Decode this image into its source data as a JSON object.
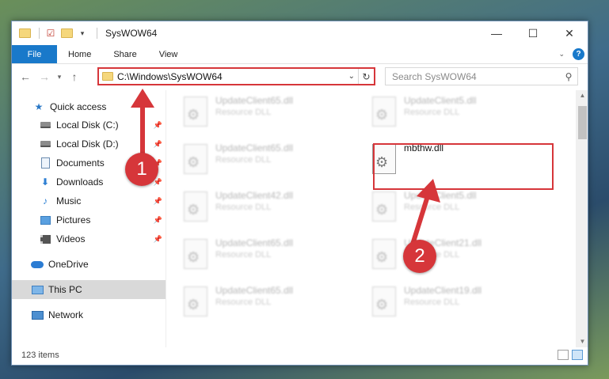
{
  "window": {
    "title": "SysWOW64",
    "controls": {
      "minimize": "—",
      "maximize": "☐",
      "close": "✕"
    }
  },
  "ribbon": {
    "file_label": "File",
    "tabs": [
      "Home",
      "Share",
      "View"
    ],
    "help": "?"
  },
  "nav": {
    "address": "C:\\Windows\\SysWOW64",
    "search_placeholder": "Search SysWOW64"
  },
  "sidebar": {
    "items": [
      {
        "label": "Quick access",
        "icon": "star-icon",
        "pinned": false
      },
      {
        "label": "Local Disk (C:)",
        "icon": "drive-icon",
        "pinned": true
      },
      {
        "label": "Local Disk (D:)",
        "icon": "drive-icon",
        "pinned": true
      },
      {
        "label": "Documents",
        "icon": "document-icon",
        "pinned": true
      },
      {
        "label": "Downloads",
        "icon": "download-icon",
        "pinned": true
      },
      {
        "label": "Music",
        "icon": "music-icon",
        "pinned": true
      },
      {
        "label": "Pictures",
        "icon": "pictures-icon",
        "pinned": true
      },
      {
        "label": "Videos",
        "icon": "videos-icon",
        "pinned": true
      },
      {
        "label": "OneDrive",
        "icon": "onedrive-icon",
        "pinned": false
      },
      {
        "label": "This PC",
        "icon": "this-pc-icon",
        "pinned": false,
        "selected": true
      },
      {
        "label": "Network",
        "icon": "network-icon",
        "pinned": false
      }
    ]
  },
  "files": [
    {
      "name": "UpdateClient65.dll",
      "type": "Resource DLL"
    },
    {
      "name": "UpdateClient5.dll",
      "type": "Resource DLL"
    },
    {
      "name": "UpdateClient65.dll",
      "type": "Resource DLL"
    },
    {
      "name": "mbthw.dll",
      "type": ""
    },
    {
      "name": "UpdateClient42.dll",
      "type": "Resource DLL"
    },
    {
      "name": "UpdateClient5.dll",
      "type": "Resource DLL"
    },
    {
      "name": "UpdateClient65.dll",
      "type": "Resource DLL"
    },
    {
      "name": "UpdateClient21.dll",
      "type": "Resource DLL"
    },
    {
      "name": "UpdateClient65.dll",
      "type": "Resource DLL"
    },
    {
      "name": "UpdateClient19.dll",
      "type": "Resource DLL"
    }
  ],
  "status": {
    "items_count": "123 items"
  },
  "annotations": {
    "step1": "1",
    "step2": "2"
  },
  "colors": {
    "accent": "#1979ca",
    "highlight": "#d6363a"
  }
}
